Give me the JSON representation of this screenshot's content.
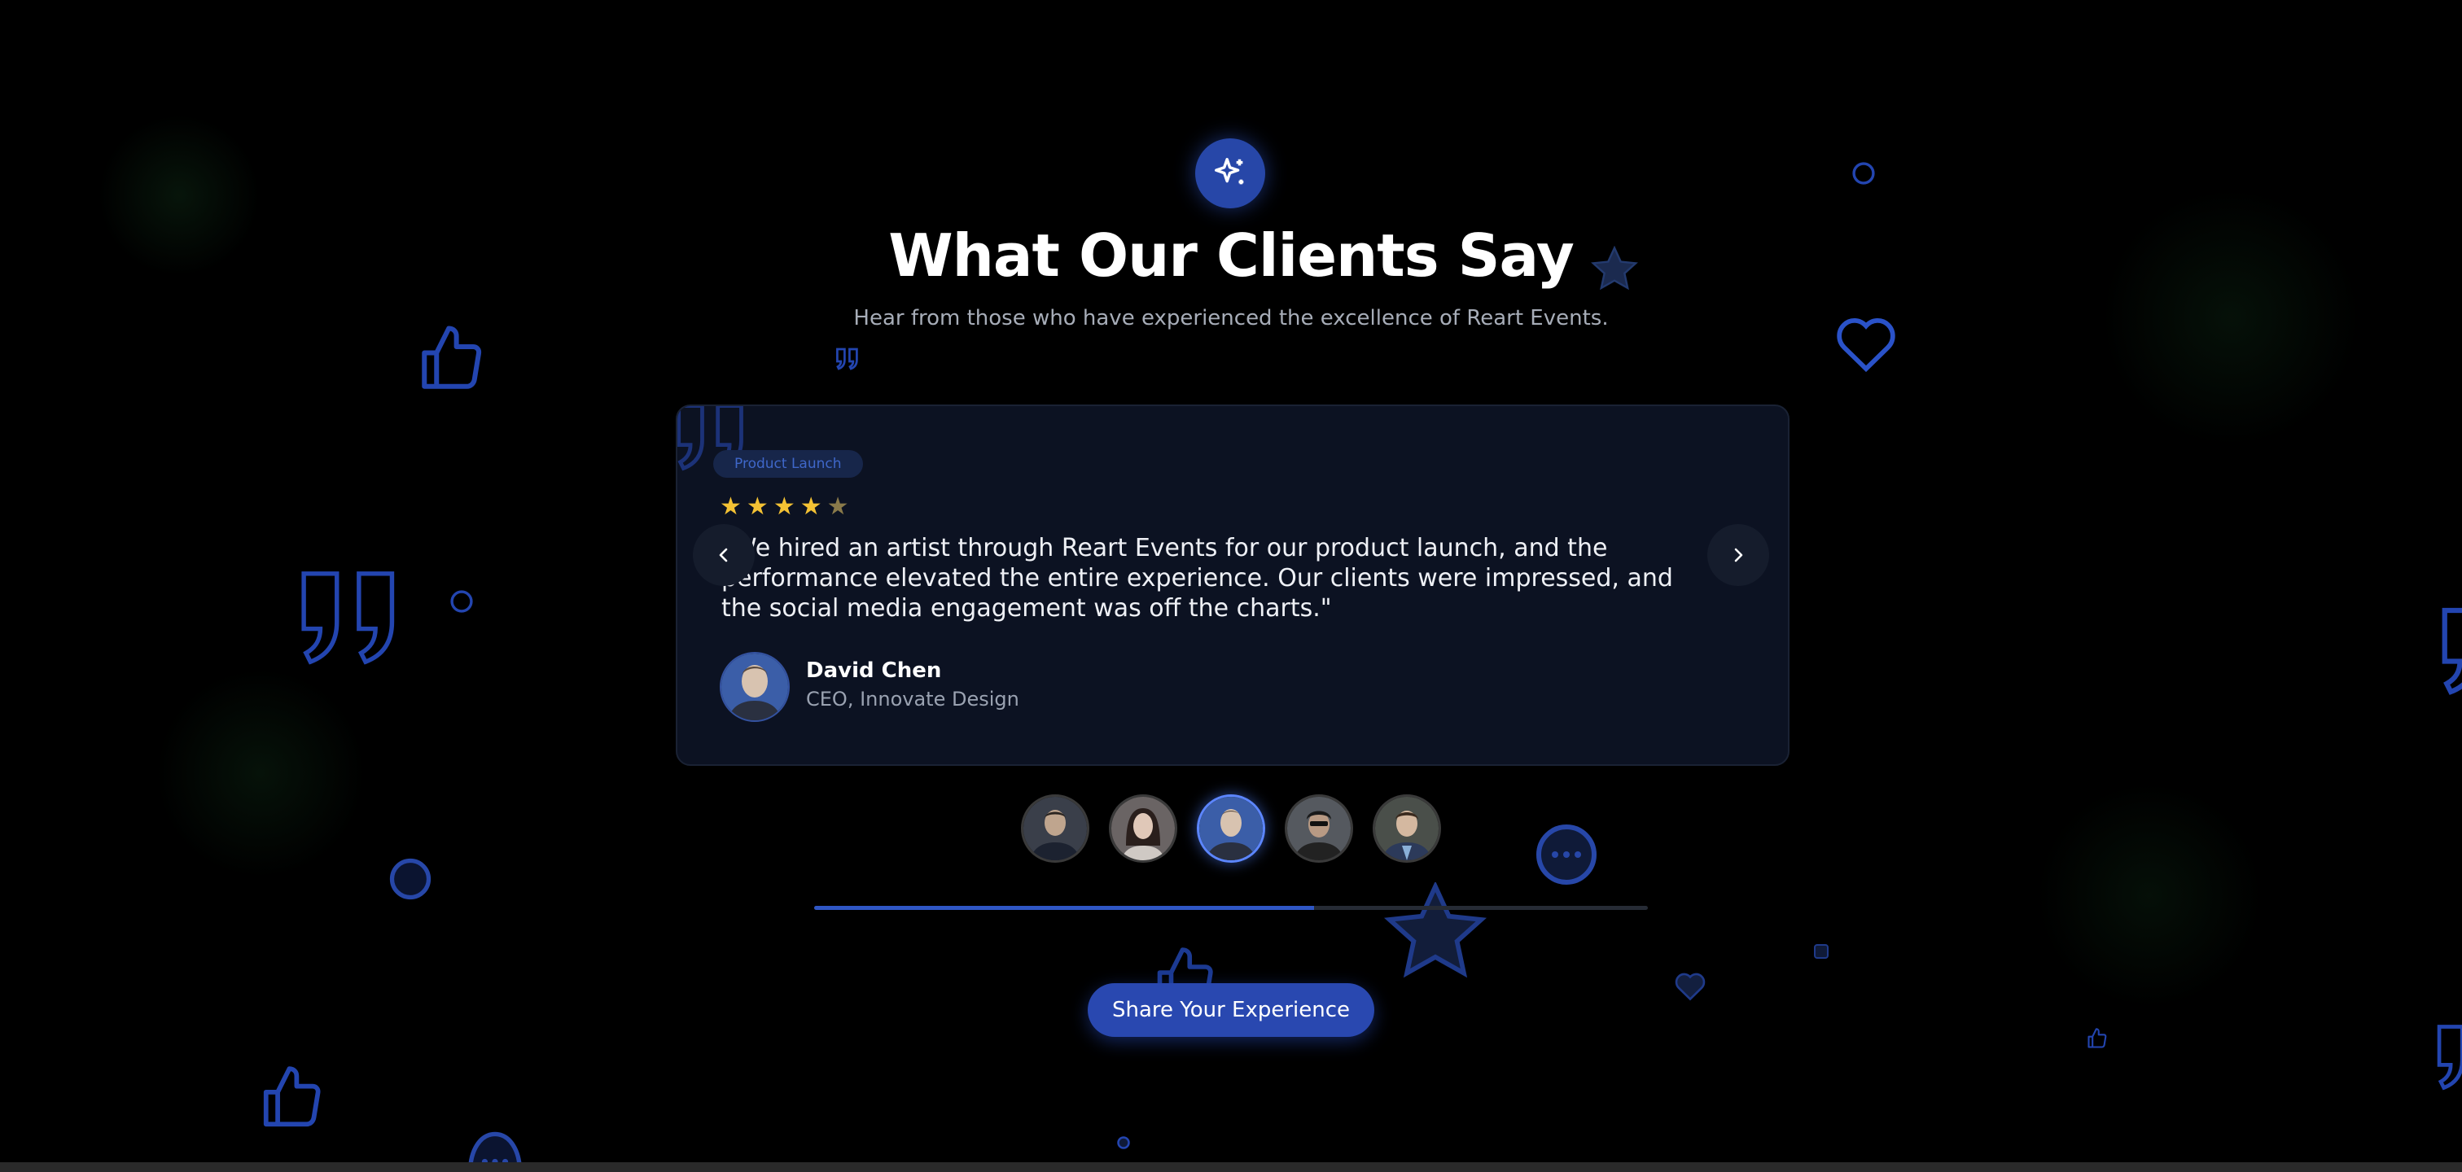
{
  "header": {
    "icon": "sparkles-icon",
    "title": "What Our Clients Say",
    "subtitle": "Hear from those who have experienced the excellence of Reart Events."
  },
  "testimonial": {
    "tag": "Product Launch",
    "rating": 4,
    "rating_max": 5,
    "quote": "\"We hired an artist through Reart Events for our product launch, and the performance elevated the entire experience. Our clients were impressed, and the social media engagement was off the charts.\"",
    "author_name": "David Chen",
    "author_role": "CEO, Innovate Design"
  },
  "carousel": {
    "prev_icon": "chevron-left-icon",
    "next_icon": "chevron-right-icon",
    "active_index": 2,
    "thumbnail_count": 5,
    "progress": 0.6
  },
  "cta": {
    "label": "Share Your Experience"
  },
  "colors": {
    "accent": "#2948b0",
    "star": "#f4c234",
    "background": "#000000",
    "card": "#0c1222"
  }
}
